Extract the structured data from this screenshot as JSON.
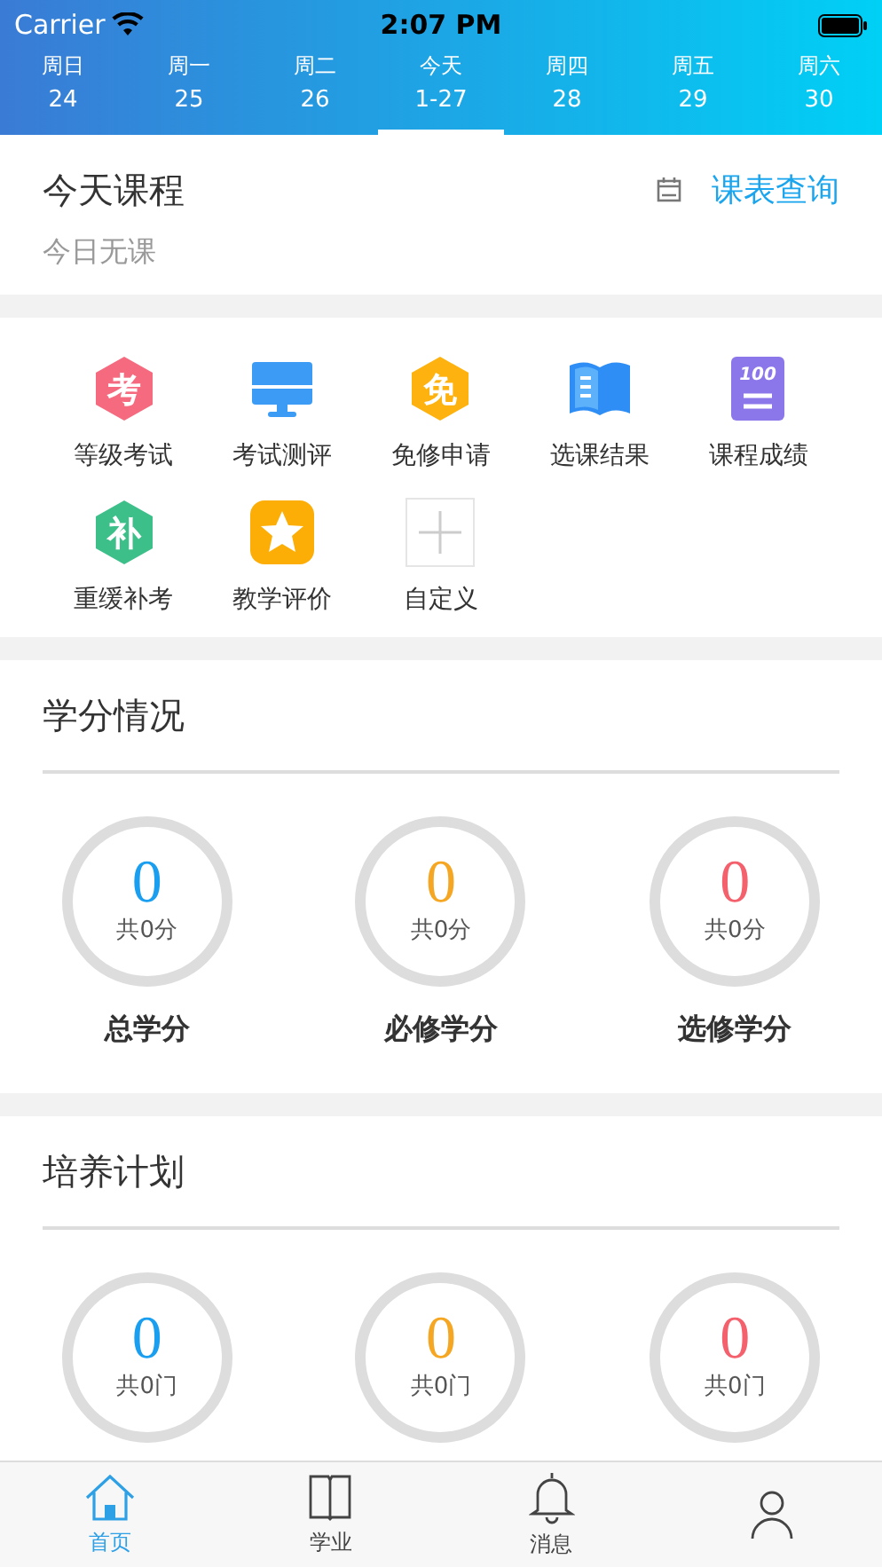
{
  "status_bar": {
    "carrier": "Carrier",
    "time": "2:07 PM"
  },
  "week": [
    {
      "day": "周日",
      "date": "24",
      "selected": false
    },
    {
      "day": "周一",
      "date": "25",
      "selected": false
    },
    {
      "day": "周二",
      "date": "26",
      "selected": false
    },
    {
      "day": "今天",
      "date": "1-27",
      "selected": true
    },
    {
      "day": "周四",
      "date": "28",
      "selected": false
    },
    {
      "day": "周五",
      "date": "29",
      "selected": false
    },
    {
      "day": "周六",
      "date": "30",
      "selected": false
    }
  ],
  "today": {
    "title": "今天课程",
    "link": "课表查询",
    "empty": "今日无课"
  },
  "shortcuts": [
    {
      "label": "等级考试",
      "kind": "hex",
      "glyph": "考",
      "color": "#f66a7f"
    },
    {
      "label": "考试测评",
      "kind": "monitor"
    },
    {
      "label": "免修申请",
      "kind": "hex",
      "glyph": "免",
      "color": "#fdb20f"
    },
    {
      "label": "选课结果",
      "kind": "book"
    },
    {
      "label": "课程成绩",
      "kind": "score",
      "glyph": "100"
    },
    {
      "label": "重缓补考",
      "kind": "hex",
      "glyph": "补",
      "color": "#3dbf8a"
    },
    {
      "label": "教学评价",
      "kind": "star"
    },
    {
      "label": "自定义",
      "kind": "plus"
    }
  ],
  "sections": [
    {
      "title": "学分情况",
      "stats": [
        {
          "value": "0",
          "total": "共0分",
          "label": "总学分",
          "color": "#1a9ff0"
        },
        {
          "value": "0",
          "total": "共0分",
          "label": "必修学分",
          "color": "#f5a623"
        },
        {
          "value": "0",
          "total": "共0分",
          "label": "选修学分",
          "color": "#f4606c"
        }
      ]
    },
    {
      "title": "培养计划",
      "stats": [
        {
          "value": "0",
          "total": "共0门",
          "color": "#1a9ff0"
        },
        {
          "value": "0",
          "total": "共0门",
          "color": "#f5a623"
        },
        {
          "value": "0",
          "total": "共0门",
          "color": "#f4606c"
        }
      ]
    }
  ],
  "tab_bar": [
    {
      "kind": "home",
      "label": "首页",
      "selected": true
    },
    {
      "kind": "book",
      "label": "学业",
      "selected": false
    },
    {
      "kind": "bell",
      "label": "消息",
      "selected": false
    },
    {
      "kind": "person",
      "selected": false
    }
  ]
}
